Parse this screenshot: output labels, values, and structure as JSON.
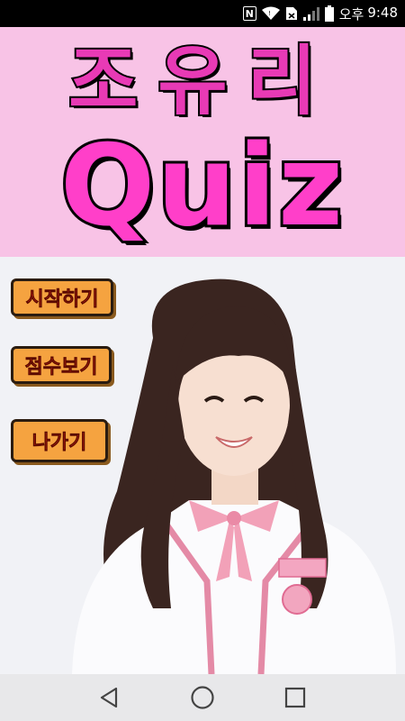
{
  "status_bar": {
    "nfc_label": "N",
    "time_prefix": "오후",
    "time": "9:48",
    "icons": [
      "nfc-icon",
      "wifi-icon",
      "sim-icon",
      "signal-icon",
      "battery-icon"
    ]
  },
  "header": {
    "title_korean": "조유리",
    "title_quiz": "Quiz",
    "background": "#f8c3e6",
    "title_color": "#ff3fc9"
  },
  "menu": {
    "start_label": "시작하기",
    "score_label": "점수보기",
    "exit_label": "나가기",
    "button_color": "#f5a340",
    "label_color": "#e02a1a"
  },
  "nav_bar": {
    "icons": [
      "back-icon",
      "home-icon",
      "recents-icon"
    ]
  }
}
